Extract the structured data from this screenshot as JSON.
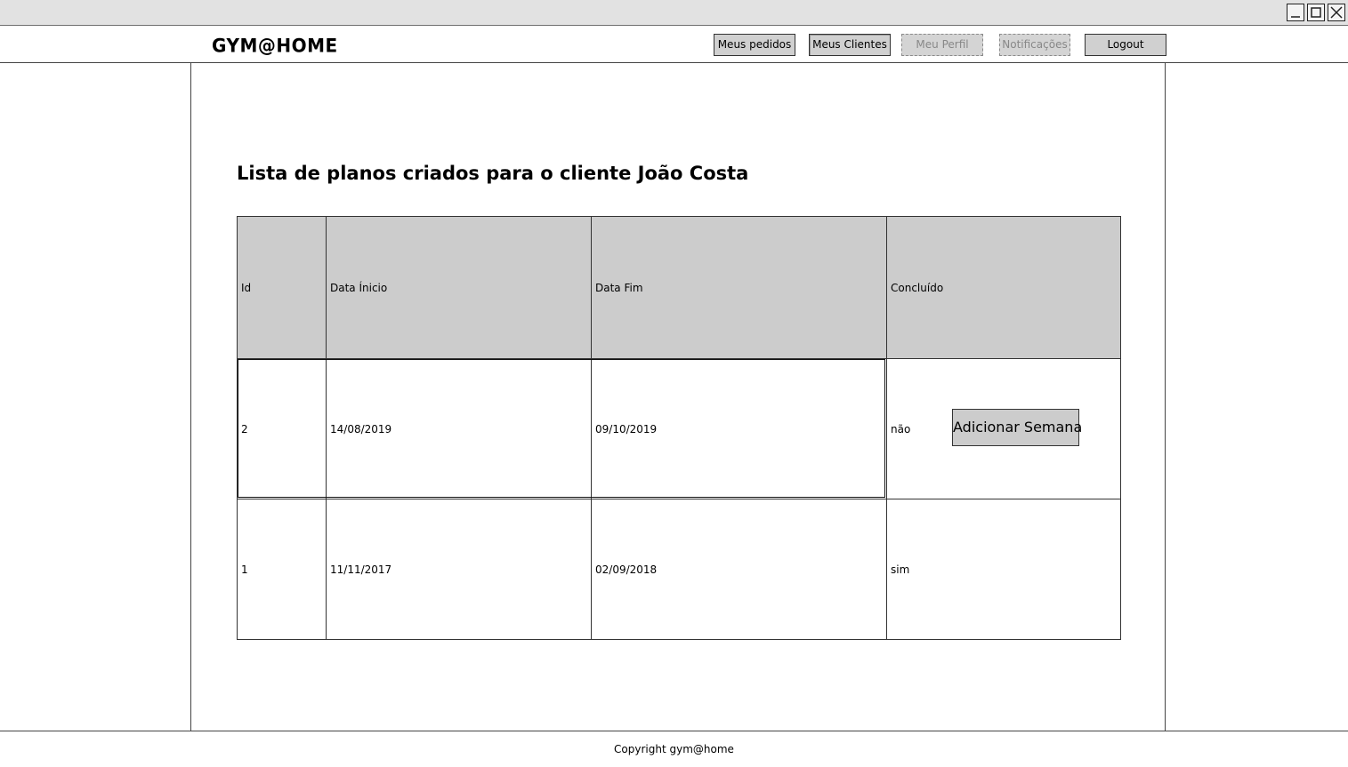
{
  "window": {
    "controls": {
      "minimize_icon": "minimize-icon",
      "maximize_icon": "maximize-icon",
      "close_icon": "close-icon"
    }
  },
  "header": {
    "logo": "GYM@HOME",
    "nav": {
      "orders": "Meus pedidos",
      "clients": "Meus Clientes",
      "profile": "Meu Perfil",
      "notifications": "Notificações",
      "logout": "Logout"
    }
  },
  "main": {
    "title": "Lista de planos criados para o cliente João Costa",
    "table": {
      "columns": [
        "Id",
        "Data Ínicio",
        "Data Fim",
        "Concluído"
      ],
      "rows": [
        {
          "id": "2",
          "start": "14/08/2019",
          "end": "09/10/2019",
          "done": "não",
          "action": "Adicionar Semana"
        },
        {
          "id": "1",
          "start": "11/11/2017",
          "end": "02/09/2018",
          "done": "sim"
        }
      ]
    }
  },
  "footer": {
    "copyright": "Copyright gym@home"
  },
  "colors": {
    "header_bg": "#cccccc",
    "button_bg": "#d0d0d0",
    "disabled_text": "#888888",
    "titlebar_bg": "#e2e2e2"
  }
}
